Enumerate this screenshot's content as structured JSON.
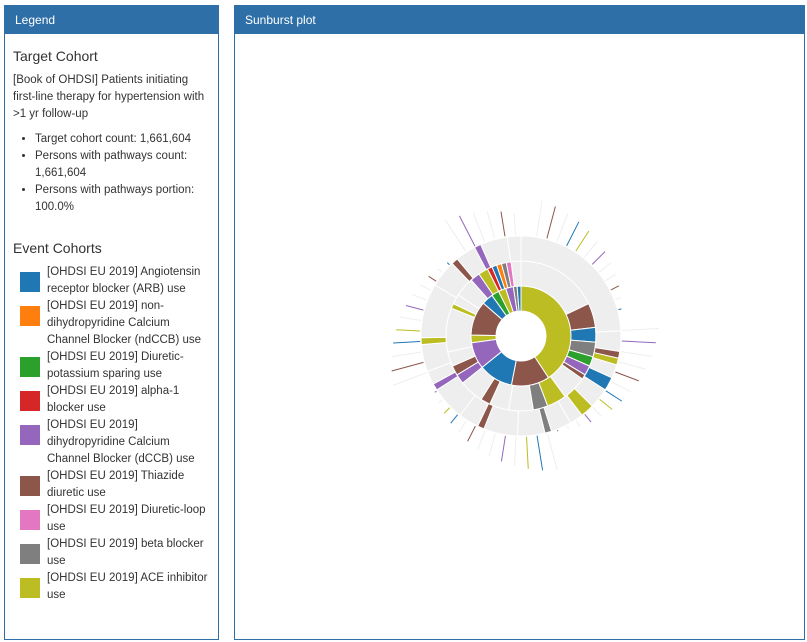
{
  "legend": {
    "header": "Legend",
    "target_title": "Target Cohort",
    "target_description": "[Book of OHDSI] Patients initiating first-line therapy for hypertension with >1 yr follow-up",
    "stats": [
      "Target cohort count: 1,661,604",
      "Persons with pathways count: 1,661,604",
      "Persons with pathways portion: 100.0%"
    ],
    "event_title": "Event Cohorts",
    "events": [
      {
        "label": "[OHDSI EU 2019] Angiotensin receptor blocker (ARB) use",
        "color": "#1f77b4"
      },
      {
        "label": "[OHDSI EU 2019] non-dihydropyridine Calcium Channel Blocker (ndCCB) use",
        "color": "#ff7f0e"
      },
      {
        "label": "[OHDSI EU 2019] Diuretic-potassium sparing use",
        "color": "#2ca02c"
      },
      {
        "label": "[OHDSI EU 2019] alpha-1 blocker use",
        "color": "#d62728"
      },
      {
        "label": "[OHDSI EU 2019] dihydropyridine Calcium Channel Blocker (dCCB) use",
        "color": "#9467bd"
      },
      {
        "label": "[OHDSI EU 2019] Thiazide diuretic use",
        "color": "#8c564b"
      },
      {
        "label": "[OHDSI EU 2019] Diuretic-loop use",
        "color": "#e377c2"
      },
      {
        "label": "[OHDSI EU 2019] beta blocker use",
        "color": "#7f7f7f"
      },
      {
        "label": "[OHDSI EU 2019] ACE inhibitor use",
        "color": "#bcbd22"
      }
    ]
  },
  "sunburst": {
    "header": "Sunburst plot",
    "end_color": "#eeeeee",
    "rings": [
      [
        {
          "value": 33,
          "color": "#bcbd22"
        },
        {
          "value": 10,
          "color": "#8c564b"
        },
        {
          "value": 9,
          "color": "#1f77b4"
        },
        {
          "value": 7,
          "color": "#9467bd"
        },
        {
          "value": 2,
          "color": "#bcbd22"
        },
        {
          "value": 9,
          "color": "#8c564b"
        },
        {
          "value": 3,
          "color": "#1f77b4"
        },
        {
          "value": 2,
          "color": "#2ca02c"
        },
        {
          "value": 2,
          "color": "#bcbd22"
        },
        {
          "value": 2,
          "color": "#9467bd"
        },
        {
          "value": 1,
          "color": "#7f7f7f"
        },
        {
          "value": 1,
          "color": "#1f77b4"
        }
      ],
      [
        {
          "value": 17,
          "color": "#eeeeee"
        },
        {
          "value": 5,
          "color": "#8c564b"
        },
        {
          "value": 3,
          "color": "#1f77b4"
        },
        {
          "value": 3,
          "color": "#7f7f7f"
        },
        {
          "value": 2,
          "color": "#2ca02c"
        },
        {
          "value": 2,
          "color": "#9467bd"
        },
        {
          "value": 1,
          "color": "#8c564b"
        },
        {
          "value": 5,
          "color": "#eeeeee"
        },
        {
          "value": 4,
          "color": "#bcbd22"
        },
        {
          "value": 3,
          "color": "#7f7f7f"
        },
        {
          "value": 5,
          "color": "#eeeeee"
        },
        {
          "value": 4,
          "color": "#eeeeee"
        },
        {
          "value": 2,
          "color": "#8c564b"
        },
        {
          "value": 5,
          "color": "#eeeeee"
        },
        {
          "value": 2,
          "color": "#9467bd"
        },
        {
          "value": 2,
          "color": "#8c564b"
        },
        {
          "value": 3,
          "color": "#eeeeee"
        },
        {
          "value": 9,
          "color": "#eeeeee"
        },
        {
          "value": 1,
          "color": "#bcbd22"
        },
        {
          "value": 2,
          "color": "#eeeeee"
        },
        {
          "value": 4,
          "color": "#eeeeee"
        },
        {
          "value": 2,
          "color": "#9467bd"
        },
        {
          "value": 2,
          "color": "#bcbd22"
        },
        {
          "value": 1,
          "color": "#d62728"
        },
        {
          "value": 1,
          "color": "#1f77b4"
        },
        {
          "value": 1,
          "color": "#ff7f0e"
        },
        {
          "value": 1,
          "color": "#7f7f7f"
        },
        {
          "value": 1,
          "color": "#e377c2"
        },
        {
          "value": 2,
          "color": "#eeeeee"
        }
      ],
      [
        {
          "value": 22,
          "color": "#eeeeee"
        },
        {
          "value": 3,
          "color": "#eeeeee"
        },
        {
          "value": 1,
          "color": "#8c564b"
        },
        {
          "value": 1,
          "color": "#bcbd22"
        },
        {
          "value": 2,
          "color": "#eeeeee"
        },
        {
          "value": 2,
          "color": "#1f77b4"
        },
        {
          "value": 3,
          "color": "#eeeeee"
        },
        {
          "value": 2,
          "color": "#bcbd22"
        },
        {
          "value": 2,
          "color": "#eeeeee"
        },
        {
          "value": 3,
          "color": "#eeeeee"
        },
        {
          "value": 1,
          "color": "#7f7f7f"
        },
        {
          "value": 4,
          "color": "#eeeeee"
        },
        {
          "value": 5,
          "color": "#eeeeee"
        },
        {
          "value": 1,
          "color": "#8c564b"
        },
        {
          "value": 3,
          "color": "#eeeeee"
        },
        {
          "value": 5,
          "color": "#eeeeee"
        },
        {
          "value": 1,
          "color": "#9467bd"
        },
        {
          "value": 2,
          "color": "#eeeeee"
        },
        {
          "value": 4,
          "color": "#eeeeee"
        },
        {
          "value": 1,
          "color": "#bcbd22"
        },
        {
          "value": 8,
          "color": "#eeeeee"
        },
        {
          "value": 4,
          "color": "#eeeeee"
        },
        {
          "value": 1,
          "color": "#8c564b"
        },
        {
          "value": 3,
          "color": "#eeeeee"
        },
        {
          "value": 1,
          "color": "#9467bd"
        },
        {
          "value": 4,
          "color": "#eeeeee"
        },
        {
          "value": 2,
          "color": "#eeeeee"
        }
      ]
    ]
  }
}
